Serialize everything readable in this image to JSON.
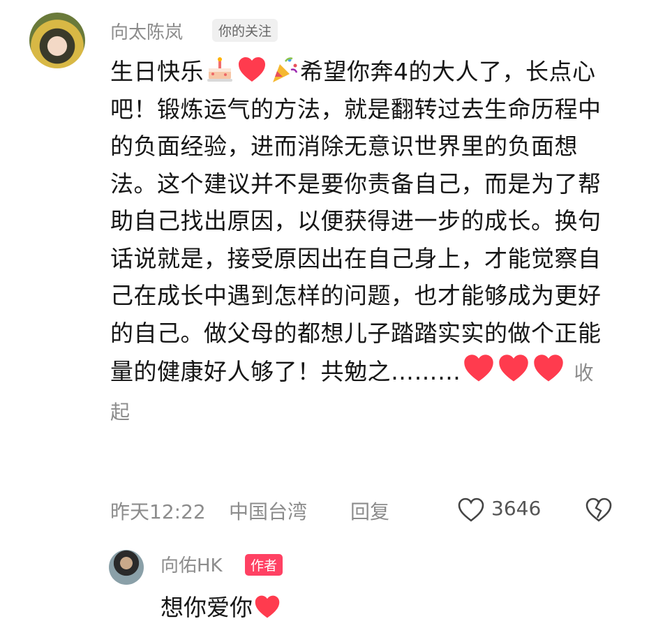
{
  "comment": {
    "avatar": "user-avatar",
    "author": "向太陈岚",
    "badge": "你的关注",
    "text_line1_a": "生日快乐",
    "text_line1_b": "希望你奔4的大人了，长",
    "text_rest": "点心吧！锻炼运气的方法，就是翻转过去生命历程中的负面经验，进而消除无意识世界里的负面想法。这个建议并不是要你责备自己，而是为了帮助自己找出原因，以便获得进一步的成长。换句话说就是，接受原因出在自己身上，才能觉察自己在成长中遇到怎样的问题，也才能够成为更好的自己。做父母的都想儿子踏踏实实的做个正能量的健康好人够了！共勉之………",
    "collapse_label": "收起",
    "time": "昨天12:22",
    "location": "中国台湾",
    "reply_label": "回复",
    "like_count": "3646",
    "icons": [
      "cake-emoji",
      "heart-emoji",
      "party-popper-emoji",
      "like-heart-icon",
      "dislike-broken-heart-icon"
    ]
  },
  "reply": {
    "author": "向佑HK",
    "tag": "作者",
    "text": "想你爱你"
  },
  "colors": {
    "heart": "#ff3b4e",
    "author_tag": "#ff4163",
    "meta": "#8c8c8c"
  }
}
